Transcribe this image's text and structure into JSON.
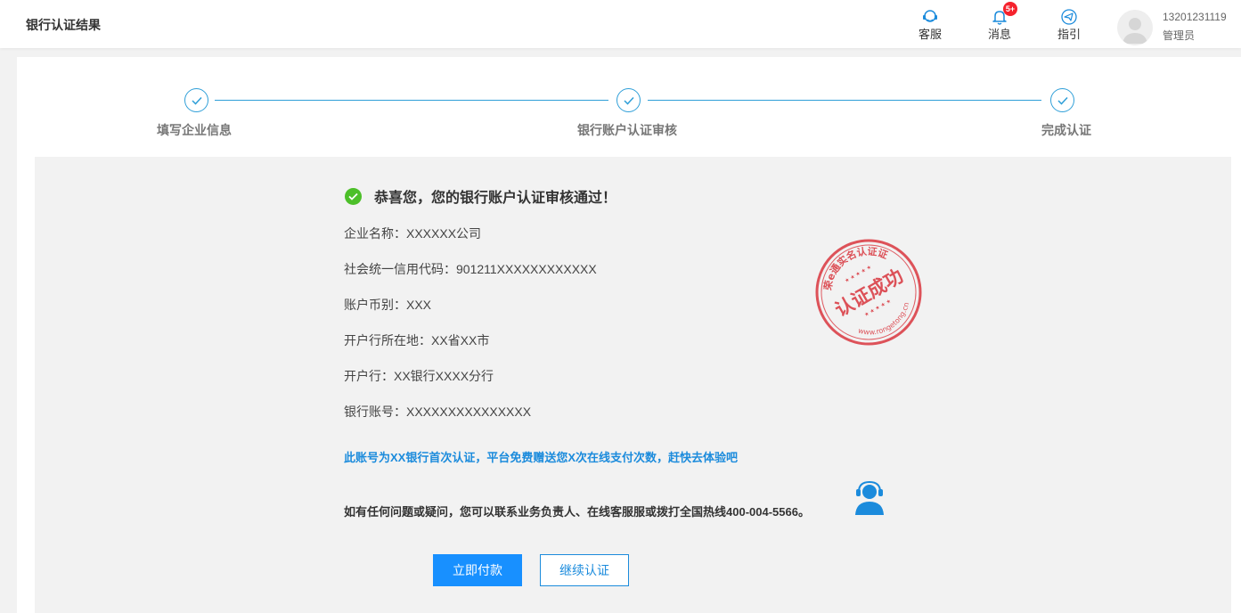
{
  "header": {
    "title": "银行认证结果",
    "actions": [
      {
        "label": "客服",
        "icon": "customer-service-icon"
      },
      {
        "label": "消息",
        "icon": "bell-icon",
        "badge": "5+"
      },
      {
        "label": "指引",
        "icon": "send-icon"
      }
    ],
    "user": {
      "phone": "13201231119",
      "role": "管理员"
    }
  },
  "steps": [
    {
      "label": "填写企业信息",
      "status": "done"
    },
    {
      "label": "银行账户认证审核",
      "status": "done"
    },
    {
      "label": "完成认证",
      "status": "done"
    }
  ],
  "result": {
    "title": "恭喜您，您的银行账户认证审核通过！",
    "fields": [
      {
        "key": "企业名称",
        "value": "XXXXXX公司"
      },
      {
        "key": "社会统一信用代码",
        "value": "901211XXXXXXXXXXXX"
      },
      {
        "key": "账户币别",
        "value": "XXX"
      },
      {
        "key": "开户行所在地",
        "value": "XX省XX市"
      },
      {
        "key": "开户行",
        "value": "XX银行XXXX分行"
      },
      {
        "key": "银行账号",
        "value": "XXXXXXXXXXXXXXX"
      }
    ],
    "promo": "此账号为XX银行首次认证，平台免费赠送您X次在线支付次数，赶快去体验吧",
    "contact": "如有任何问题或疑问，您可以联系业务负责人、在线客服服或拨打全国热线400-004-5566。",
    "stamp": {
      "top_text": "荣e通实名认证证",
      "center_text": "认证成功",
      "bottom_text": "www.rongetong.cn"
    }
  },
  "buttons": {
    "pay": "立即付款",
    "continue": "继续认证"
  },
  "colors": {
    "primary": "#1890ff",
    "step": "#2f9fd8",
    "success": "#4cbf29",
    "stamp": "#d9363e",
    "badge": "#f5222d"
  }
}
